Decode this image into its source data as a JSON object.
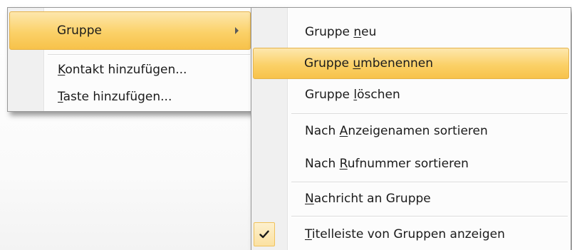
{
  "menu": {
    "items": [
      {
        "label": "Gruppe",
        "accesskey_index": null,
        "has_submenu": true,
        "highlighted": true
      },
      {
        "label": "Kontakt hinzufügen...",
        "accesskey_index": 0
      },
      {
        "label": "Taste hinzufügen...",
        "accesskey_index": 0
      }
    ]
  },
  "submenu": {
    "items": [
      {
        "label": "Gruppe neu",
        "accesskey_index": 7
      },
      {
        "label": "Gruppe umbenennen",
        "accesskey_index": 7,
        "highlighted": true
      },
      {
        "label": "Gruppe löschen",
        "accesskey_index": 7
      },
      {
        "label": "Nach Anzeigenamen sortieren",
        "accesskey_index": 5
      },
      {
        "label": "Nach Rufnummer sortieren",
        "accesskey_index": 5
      },
      {
        "label": "Nachricht an Gruppe",
        "accesskey_index": 0
      },
      {
        "label": "Titelleiste von Gruppen anzeigen",
        "accesskey_index": 0,
        "checked": true
      }
    ]
  },
  "colors": {
    "highlight": "#fbd168",
    "gutter": "#f0f0f0",
    "text": "#1b1b1b"
  }
}
